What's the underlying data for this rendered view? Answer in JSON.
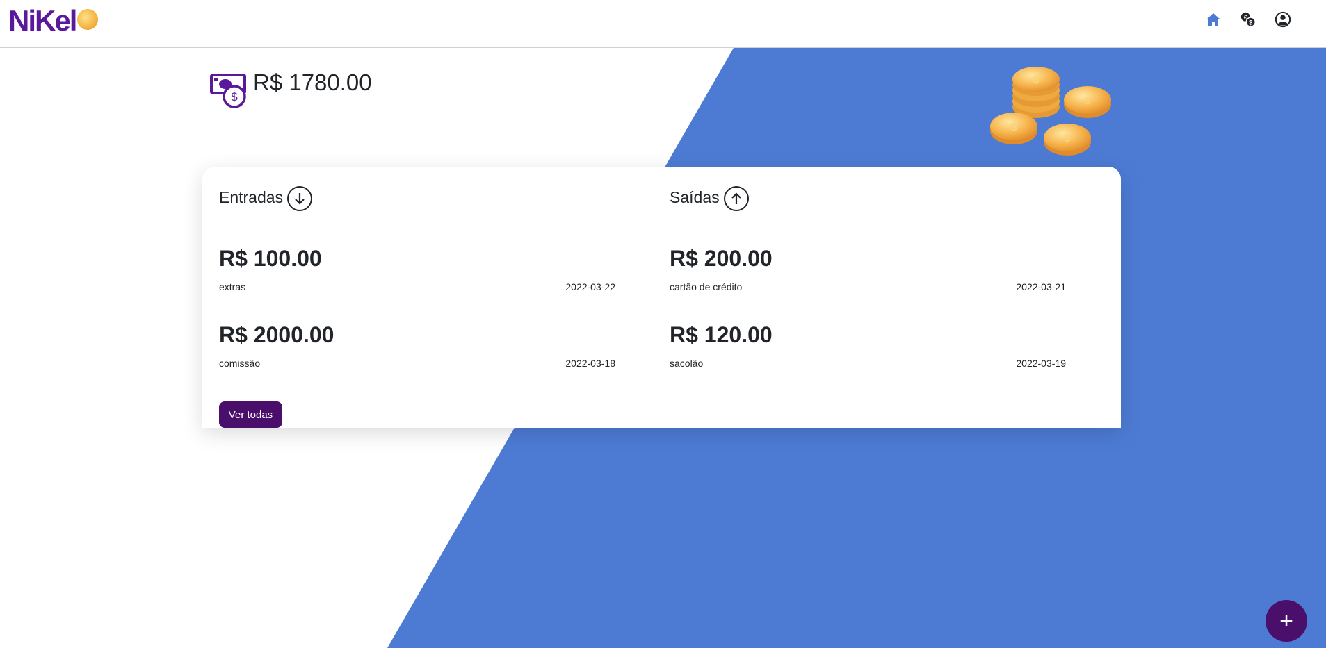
{
  "brand": {
    "logo_text": "NiKel"
  },
  "nav": {
    "icons": [
      "home-icon",
      "money-transfer-icon",
      "user-icon"
    ],
    "active_color": "#4d7bd4"
  },
  "balance": {
    "text": "R$ 1780.00"
  },
  "colors": {
    "accent": "#4a0e6b",
    "background_blue": "#4d7bd4"
  },
  "entradas": {
    "title": "Entradas",
    "items": [
      {
        "amount": "R$ 100.00",
        "description": "extras",
        "date": "2022-03-22"
      },
      {
        "amount": "R$ 2000.00",
        "description": "comissão",
        "date": "2022-03-18"
      }
    ]
  },
  "saidas": {
    "title": "Saídas",
    "items": [
      {
        "amount": "R$ 200.00",
        "description": "cartão de crédito",
        "date": "2022-03-21"
      },
      {
        "amount": "R$ 120.00",
        "description": "sacolão",
        "date": "2022-03-19"
      }
    ]
  },
  "actions": {
    "view_all": "Ver todas",
    "add": "+"
  }
}
